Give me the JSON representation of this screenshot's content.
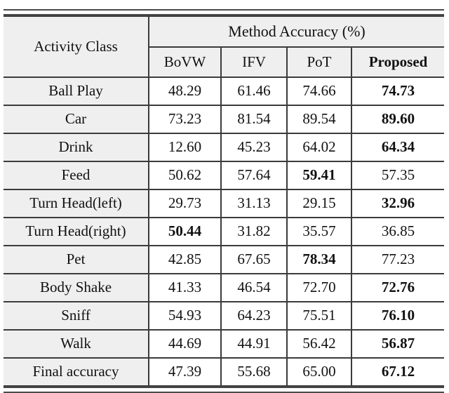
{
  "table": {
    "header": {
      "activity_class": "Activity Class",
      "group_header": "Method Accuracy (%)",
      "methods": [
        "BoVW",
        "IFV",
        "PoT",
        "Proposed"
      ],
      "method_bold": [
        false,
        false,
        false,
        true
      ]
    },
    "rows": [
      {
        "label": "Ball Play",
        "values": [
          "48.29",
          "61.46",
          "74.66",
          "74.73"
        ],
        "bold": [
          false,
          false,
          false,
          true
        ]
      },
      {
        "label": "Car",
        "values": [
          "73.23",
          "81.54",
          "89.54",
          "89.60"
        ],
        "bold": [
          false,
          false,
          false,
          true
        ]
      },
      {
        "label": "Drink",
        "values": [
          "12.60",
          "45.23",
          "64.02",
          "64.34"
        ],
        "bold": [
          false,
          false,
          false,
          true
        ]
      },
      {
        "label": "Feed",
        "values": [
          "50.62",
          "57.64",
          "59.41",
          "57.35"
        ],
        "bold": [
          false,
          false,
          true,
          false
        ]
      },
      {
        "label": "Turn Head(left)",
        "values": [
          "29.73",
          "31.13",
          "29.15",
          "32.96"
        ],
        "bold": [
          false,
          false,
          false,
          true
        ]
      },
      {
        "label": "Turn Head(right)",
        "values": [
          "50.44",
          "31.82",
          "35.57",
          "36.85"
        ],
        "bold": [
          true,
          false,
          false,
          false
        ]
      },
      {
        "label": "Pet",
        "values": [
          "42.85",
          "67.65",
          "78.34",
          "77.23"
        ],
        "bold": [
          false,
          false,
          true,
          false
        ]
      },
      {
        "label": "Body Shake",
        "values": [
          "41.33",
          "46.54",
          "72.70",
          "72.76"
        ],
        "bold": [
          false,
          false,
          false,
          true
        ]
      },
      {
        "label": "Sniff",
        "values": [
          "54.93",
          "64.23",
          "75.51",
          "76.10"
        ],
        "bold": [
          false,
          false,
          false,
          true
        ]
      },
      {
        "label": "Walk",
        "values": [
          "44.69",
          "44.91",
          "56.42",
          "56.87"
        ],
        "bold": [
          false,
          false,
          false,
          true
        ]
      },
      {
        "label": "Final accuracy",
        "values": [
          "47.39",
          "55.68",
          "65.00",
          "67.12"
        ],
        "bold": [
          false,
          false,
          false,
          true
        ]
      }
    ],
    "colors": {
      "label_cell_background": "#efefef",
      "value_cell_background": "#ffffff",
      "rule": "#3b3b3b",
      "text": "#111111"
    }
  }
}
